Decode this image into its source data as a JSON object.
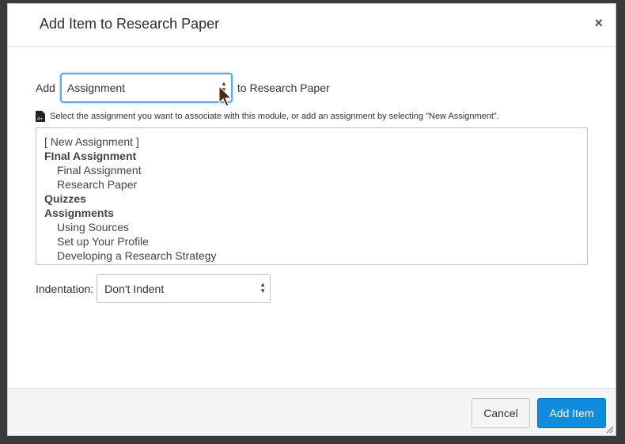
{
  "dialog": {
    "title": "Add Item to Research Paper",
    "close_glyph": "×"
  },
  "add_row": {
    "prefix": "Add",
    "selected_type": "Assignment",
    "suffix": "to Research Paper"
  },
  "hint": {
    "icon": "document-icon",
    "text": "Select the assignment you want to associate with this module, or add an assignment by selecting \"New Assignment\"."
  },
  "list": {
    "items": [
      {
        "label": "[ New Assignment ]",
        "kind": "option"
      },
      {
        "label": "FInal Assignment",
        "kind": "group"
      },
      {
        "label": "Final Assignment",
        "kind": "child"
      },
      {
        "label": "Research Paper",
        "kind": "child"
      },
      {
        "label": "Quizzes",
        "kind": "group"
      },
      {
        "label": "Assignments",
        "kind": "group"
      },
      {
        "label": "Using Sources",
        "kind": "child"
      },
      {
        "label": "Set up Your Profile",
        "kind": "child"
      },
      {
        "label": "Developing a Research Strategy",
        "kind": "child"
      }
    ]
  },
  "indentation": {
    "label": "Indentation:",
    "value": "Don't Indent"
  },
  "footer": {
    "cancel_label": "Cancel",
    "add_label": "Add Item"
  },
  "colors": {
    "primary": "#0f8cdb",
    "focus": "#5fa8f0"
  }
}
